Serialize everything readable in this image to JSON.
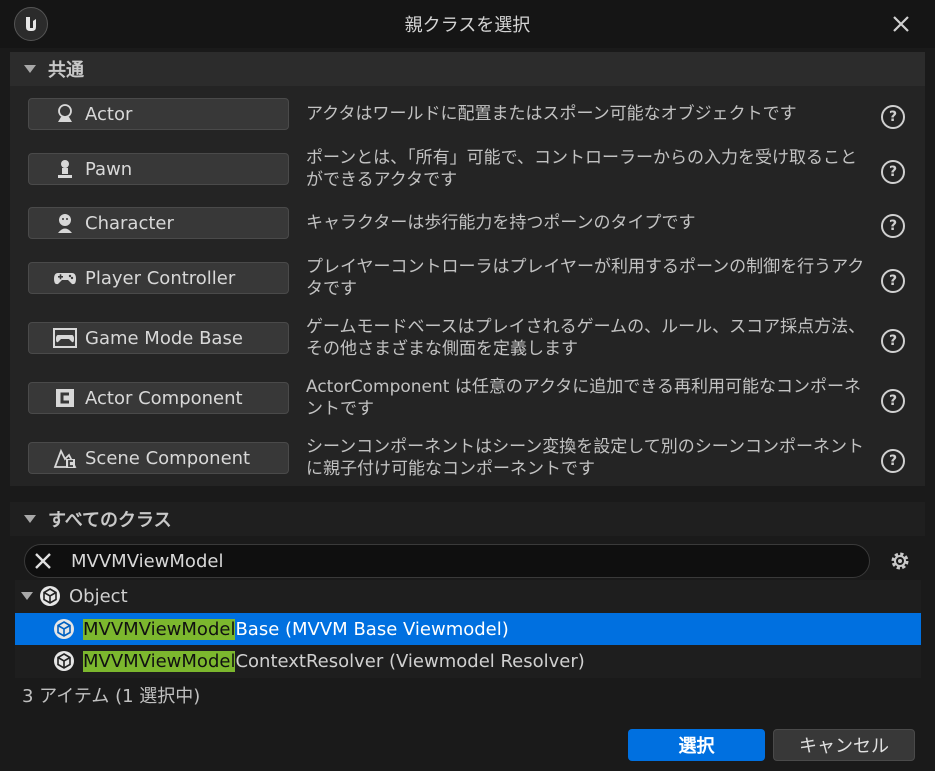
{
  "dialog": {
    "title": "親クラスを選択"
  },
  "common_section": {
    "label": "共通",
    "classes": [
      {
        "name": "Actor",
        "icon": "actor-icon",
        "description": "アクタはワールドに配置またはスポーン可能なオブジェクトです"
      },
      {
        "name": "Pawn",
        "icon": "pawn-icon",
        "description": "ポーンとは、「所有」可能で、コントローラーからの入力を受け取ることができるアクタです"
      },
      {
        "name": "Character",
        "icon": "character-icon",
        "description": "キャラクターは歩行能力を持つポーンのタイプです"
      },
      {
        "name": "Player Controller",
        "icon": "gamepad-icon",
        "description": "プレイヤーコントローラはプレイヤーが利用するポーンの制御を行うアクタです"
      },
      {
        "name": "Game Mode Base",
        "icon": "game-mode-icon",
        "description": "ゲームモードベースはプレイされるゲームの、ルール、スコア採点方法、その他さまざまな側面を定義します"
      },
      {
        "name": "Actor Component",
        "icon": "actor-component-icon",
        "description": "ActorComponent は任意のアクタに追加できる再利用可能なコンポーネントです"
      },
      {
        "name": "Scene Component",
        "icon": "scene-component-icon",
        "description": "シーンコンポーネントはシーン変換を設定して別のシーンコンポーネントに親子付け可能なコンポーネントです"
      }
    ]
  },
  "all_classes_section": {
    "label": "すべてのクラス"
  },
  "search": {
    "value": "MVVMViewModel"
  },
  "tree": {
    "root": "Object",
    "items": [
      {
        "match": "MVVMViewModel",
        "rest": "Base (MVVM Base Viewmodel)",
        "selected": true
      },
      {
        "match": "MVVMViewModel",
        "rest": "ContextResolver (Viewmodel Resolver)",
        "selected": false
      }
    ]
  },
  "status": {
    "item_count": "3 アイテム (1 選択中)"
  },
  "buttons": {
    "select": "選択",
    "cancel": "キャンセル"
  },
  "colors": {
    "accent": "#0070e0",
    "highlight": "#7cb72e"
  }
}
